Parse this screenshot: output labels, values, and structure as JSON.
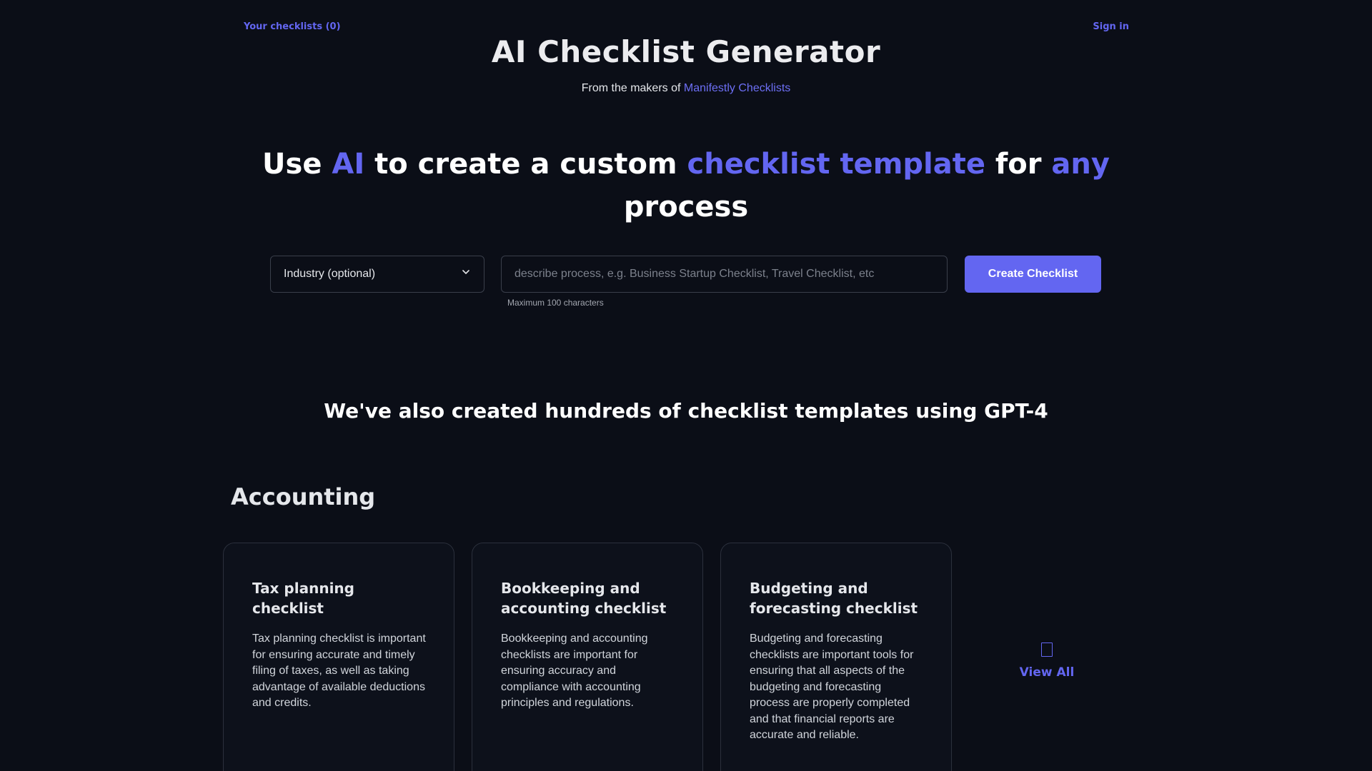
{
  "header": {
    "checklists_link": "Your checklists (0)",
    "signin_link": "Sign in",
    "app_title": "AI Checklist Generator",
    "subtitle_prefix": "From the makers of",
    "subtitle_link": "Manifestly Checklists"
  },
  "hero": {
    "part1": "Use ",
    "accent1": "AI",
    "part2": " to create a custom ",
    "accent2": "checklist template",
    "part3": " for ",
    "accent3": "any",
    "part4": " process"
  },
  "form": {
    "industry_select": "Industry (optional)",
    "process_placeholder": "describe process, e.g. Business Startup Checklist, Travel Checklist, etc",
    "process_value": "",
    "helper_text": "Maximum 100 characters",
    "create_button": "Create Checklist"
  },
  "templates": {
    "heading": "We've also created hundreds of checklist templates using GPT-4",
    "category": "Accounting",
    "cards": [
      {
        "title": "Tax planning checklist",
        "description": "Tax planning checklist is important for ensuring accurate and timely filing of taxes, as well as taking advantage of available deductions and credits."
      },
      {
        "title": "Bookkeeping and accounting checklist",
        "description": "Bookkeeping and accounting checklists are important for ensuring accuracy and compliance with accounting principles and regulations."
      },
      {
        "title": "Budgeting and forecasting checklist",
        "description": "Budgeting and forecasting checklists are important tools for ensuring that all aspects of the budgeting and forecasting process are properly completed and that financial reports are accurate and reliable."
      }
    ],
    "view_all": "View All",
    "view_all_icon": "document-icon"
  },
  "colors": {
    "accent": "#6366f1",
    "background": "#0b0e17"
  }
}
